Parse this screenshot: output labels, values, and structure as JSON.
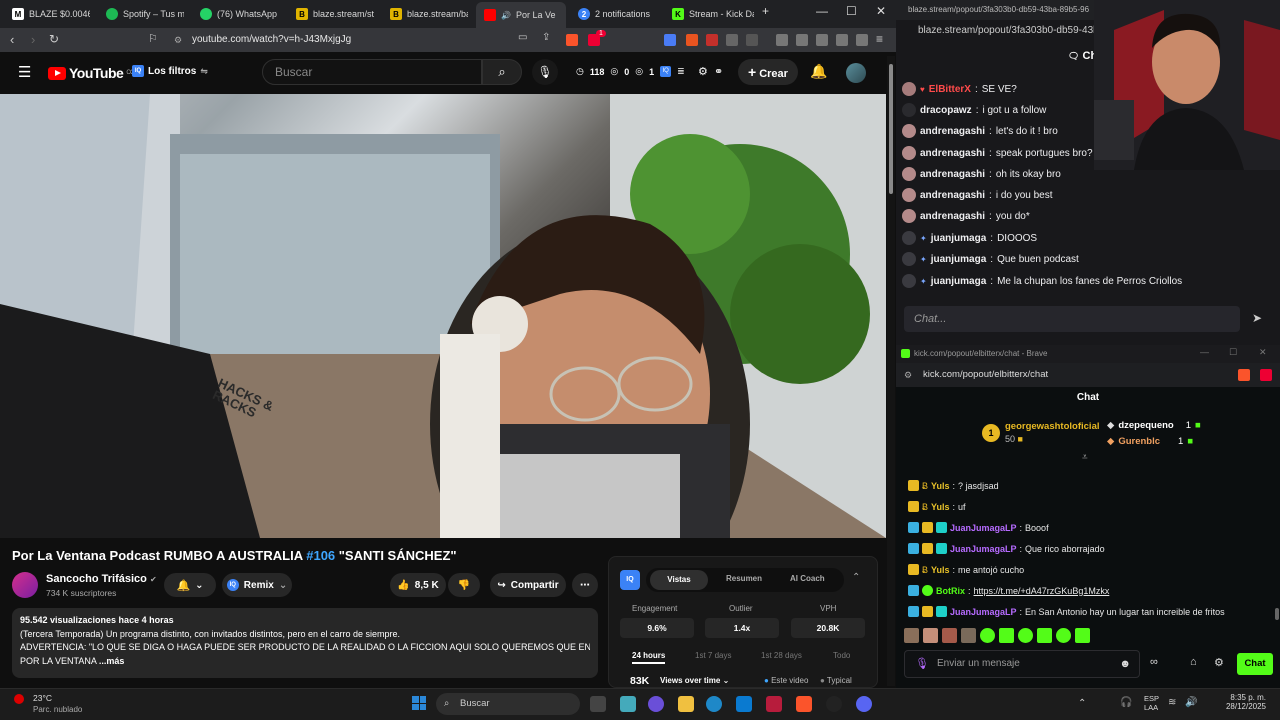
{
  "browser": {
    "tabs": [
      {
        "label": "BLAZE $0.00460",
        "icon": "blaze-icon"
      },
      {
        "label": "Spotify – Tus me",
        "icon": "spotify-icon"
      },
      {
        "label": "(76) WhatsApp",
        "icon": "whatsapp-icon"
      },
      {
        "label": "blaze.stream/stre",
        "icon": "blaze-icon"
      },
      {
        "label": "blaze.stream/bac",
        "icon": "blaze-icon"
      },
      {
        "label": "Por La Ve",
        "icon": "youtube-icon"
      },
      {
        "label": "2 notifications",
        "icon": "notification-icon"
      },
      {
        "label": "Stream - Kick Da",
        "icon": "kick-icon"
      }
    ],
    "url": "youtube.com/watch?v=h-J43MxjgJg",
    "extension_badge": "1"
  },
  "youtube": {
    "logo_text": "YouTube",
    "logo_sup": "CO",
    "filters_label": "Los filtros",
    "search_placeholder": "Buscar",
    "header_stats": {
      "a": "118",
      "b": "0",
      "c": "1"
    },
    "create_label": "Crear",
    "video": {
      "title_main": "Por La Ventana Podcast RUMBO A AUSTRALIA ",
      "title_tag": "#106",
      "title_end": " \"SANTI SÁNCHEZ\"",
      "watermark": "HACKS & RACKS"
    },
    "channel": {
      "name": "Sancocho Trifásico",
      "subs": "734 K suscriptores"
    },
    "remix_label": "Remix",
    "likes": "8,5 K",
    "share_label": "Compartir",
    "description": {
      "stats": "95.542 visualizaciones  hace 4 horas",
      "line1": "(Tercera Temporada) Un programa distinto, con invitados distintos, pero en el carro de siempre.",
      "line2": "ADVERTENCIA: \"LO QUE SE DIGA O HAGA PUEDE SER PRODUCTO DE LA REALIDAD O LA FICCION AQUI SOLO QUEREMOS QUE ENTREN",
      "line3": "POR LA VENTANA",
      "more": "...más"
    },
    "iq_panel": {
      "tabs": [
        "Vistas",
        "Resumen",
        "AI Coach"
      ],
      "metrics": [
        {
          "label": "Engagement",
          "value": "9.6%"
        },
        {
          "label": "Outlier",
          "value": "1.4x"
        },
        {
          "label": "VPH",
          "value": "20.8K"
        }
      ],
      "ranges": [
        "24 hours",
        "1st 7 days",
        "1st 28 days",
        "Todo"
      ],
      "views": "83K",
      "views_dropdown": "Views over time",
      "legend": [
        "Este video",
        "Typical"
      ]
    }
  },
  "blaze_chat": {
    "url": "blaze.stream/popout/3fa303b0-db59-43ba",
    "topbar": "blaze.stream/popout/3fa303b0-db59-43ba-89b5-96",
    "chat_tab": "Cha",
    "messages": [
      {
        "user": "ElBitterX",
        "text": "SE VE?",
        "color": "#ff4b4b"
      },
      {
        "user": "dracopawz",
        "text": "i got u a follow",
        "color": "#efeff1"
      },
      {
        "user": "andrenagashi",
        "text": "let's do it ! bro",
        "color": "#efeff1"
      },
      {
        "user": "andrenagashi",
        "text": "speak portugues bro?",
        "color": "#efeff1"
      },
      {
        "user": "andrenagashi",
        "text": "oh its okay bro",
        "color": "#efeff1"
      },
      {
        "user": "andrenagashi",
        "text": "i do you best",
        "color": "#efeff1"
      },
      {
        "user": "andrenagashi",
        "text": "you do*",
        "color": "#efeff1"
      },
      {
        "user": "juanjumaga",
        "text": "DIOOOS",
        "color": "#efeff1"
      },
      {
        "user": "juanjumaga",
        "text": "Que buen podcast",
        "color": "#efeff1"
      },
      {
        "user": "juanjumaga",
        "text": "Me la chupan los fanes de Perros Criollos",
        "color": "#efeff1"
      }
    ],
    "input_placeholder": "Chat..."
  },
  "kick_chat": {
    "window_title": "kick.com/popout/elbitterx/chat - Brave",
    "url": "kick.com/popout/elbitterx/chat",
    "header": "Chat",
    "leaderboard": [
      {
        "rank": "1",
        "name": "georgewashtoloficial",
        "value": "50"
      },
      {
        "name": "dzepequeno",
        "value": "1"
      },
      {
        "name": "Gurenblc",
        "value": "1"
      }
    ],
    "messages": [
      {
        "user": "Yuls",
        "text": "? jasdjsad",
        "color": "#e8c22a"
      },
      {
        "user": "Yuls",
        "text": "uf",
        "color": "#e8c22a"
      },
      {
        "user": "JuanJumagaLP",
        "text": "Booof",
        "color": "#b66bff"
      },
      {
        "user": "JuanJumagaLP",
        "text": "Que rico aborrajado",
        "color": "#b66bff"
      },
      {
        "user": "Yuls",
        "text": "me antojó cucho",
        "color": "#e8c22a"
      },
      {
        "user": "BotRix",
        "text": "https://t.me/+dA47rzGKuBg1Mzkx",
        "color": "#53fc18"
      },
      {
        "user": "JuanJumagaLP",
        "text": "En San Antonio hay un lugar tan increible de fritos",
        "color": "#b66bff"
      }
    ],
    "input_placeholder": "Enviar un mensaje",
    "send_label": "Chat"
  },
  "taskbar": {
    "weather_temp": "23°C",
    "weather_desc": "Parc. nublado",
    "search_label": "Buscar",
    "lang": "ESP",
    "lang2": "LAA",
    "time": "8:35 p. m.",
    "date": "28/12/2025"
  }
}
